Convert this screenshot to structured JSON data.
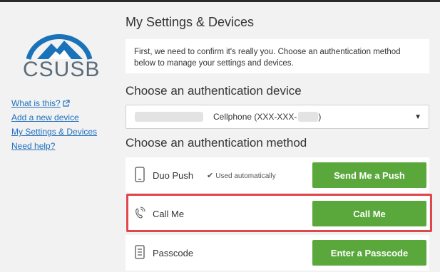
{
  "logo": {
    "text": "CSUSB"
  },
  "nav": {
    "what_is_this": "What is this?",
    "add_device": "Add a new device",
    "my_settings": "My Settings & Devices",
    "need_help": "Need help?"
  },
  "page": {
    "title": "My Settings & Devices",
    "notice": "First, we need to confirm it's really you. Choose an authentication method below to manage your settings and devices."
  },
  "device_section": {
    "heading": "Choose an authentication device",
    "selected_device_label": "Cellphone (XXX-XXX-",
    "selected_device_suffix": ")"
  },
  "method_section": {
    "heading": "Choose an authentication method",
    "methods": [
      {
        "label": "Duo Push",
        "note": "Used automatically",
        "button": "Send Me a Push",
        "icon": "phone-icon"
      },
      {
        "label": "Call Me",
        "button": "Call Me",
        "icon": "phone-call-icon"
      },
      {
        "label": "Passcode",
        "button": "Enter a Passcode",
        "icon": "passcode-token-icon"
      }
    ]
  },
  "colors": {
    "button_green": "#5aa83c",
    "highlight_red": "#e0474c",
    "link_blue": "#1f6fbf",
    "logo_blue": "#1a73b8",
    "logo_gray": "#5a6b7a"
  }
}
